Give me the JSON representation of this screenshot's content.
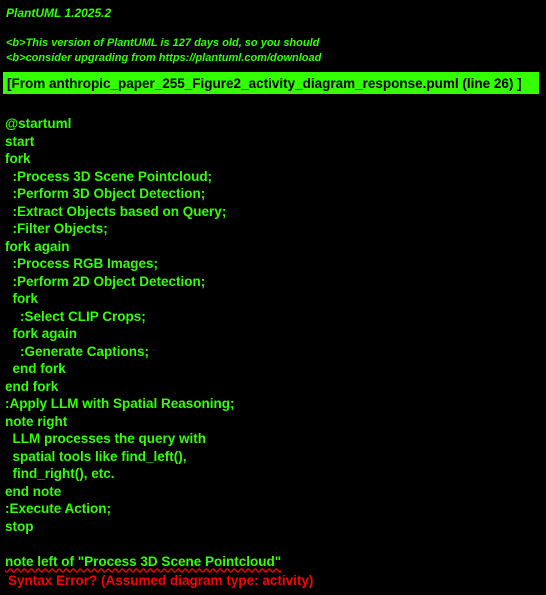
{
  "header": {
    "version": "PlantUML 1.2025.2",
    "warning_line_1": "<b>This version of PlantUML is 127 days old, so you should",
    "warning_line_2": "<b>consider upgrading from https://plantuml.com/download"
  },
  "file_banner": "[From anthropic_paper_255_Figure2_activity_diagram_response.puml (line 26) ]",
  "source_lines": [
    "@startuml",
    "start",
    "fork",
    "  :Process 3D Scene Pointcloud;",
    "  :Perform 3D Object Detection;",
    "  :Extract Objects based on Query;",
    "  :Filter Objects;",
    "fork again",
    "  :Process RGB Images;",
    "  :Perform 2D Object Detection;",
    "  fork",
    "    :Select CLIP Crops;",
    "  fork again",
    "    :Generate Captions;",
    "  end fork",
    "end fork",
    ":Apply LLM with Spatial Reasoning;",
    "note right",
    "  LLM processes the query with",
    "  spatial tools like find_left(),",
    "  find_right(), etc.",
    "end note",
    ":Execute Action;",
    "stop",
    "",
    "note left of \"Process 3D Scene Pointcloud\""
  ],
  "error_message": " Syntax Error? (Assumed diagram type: activity)",
  "colors": {
    "background": "#000000",
    "text": "#33FF02",
    "banner_bg": "#33FF02",
    "banner_text": "#000000",
    "error": "#FF0000"
  }
}
